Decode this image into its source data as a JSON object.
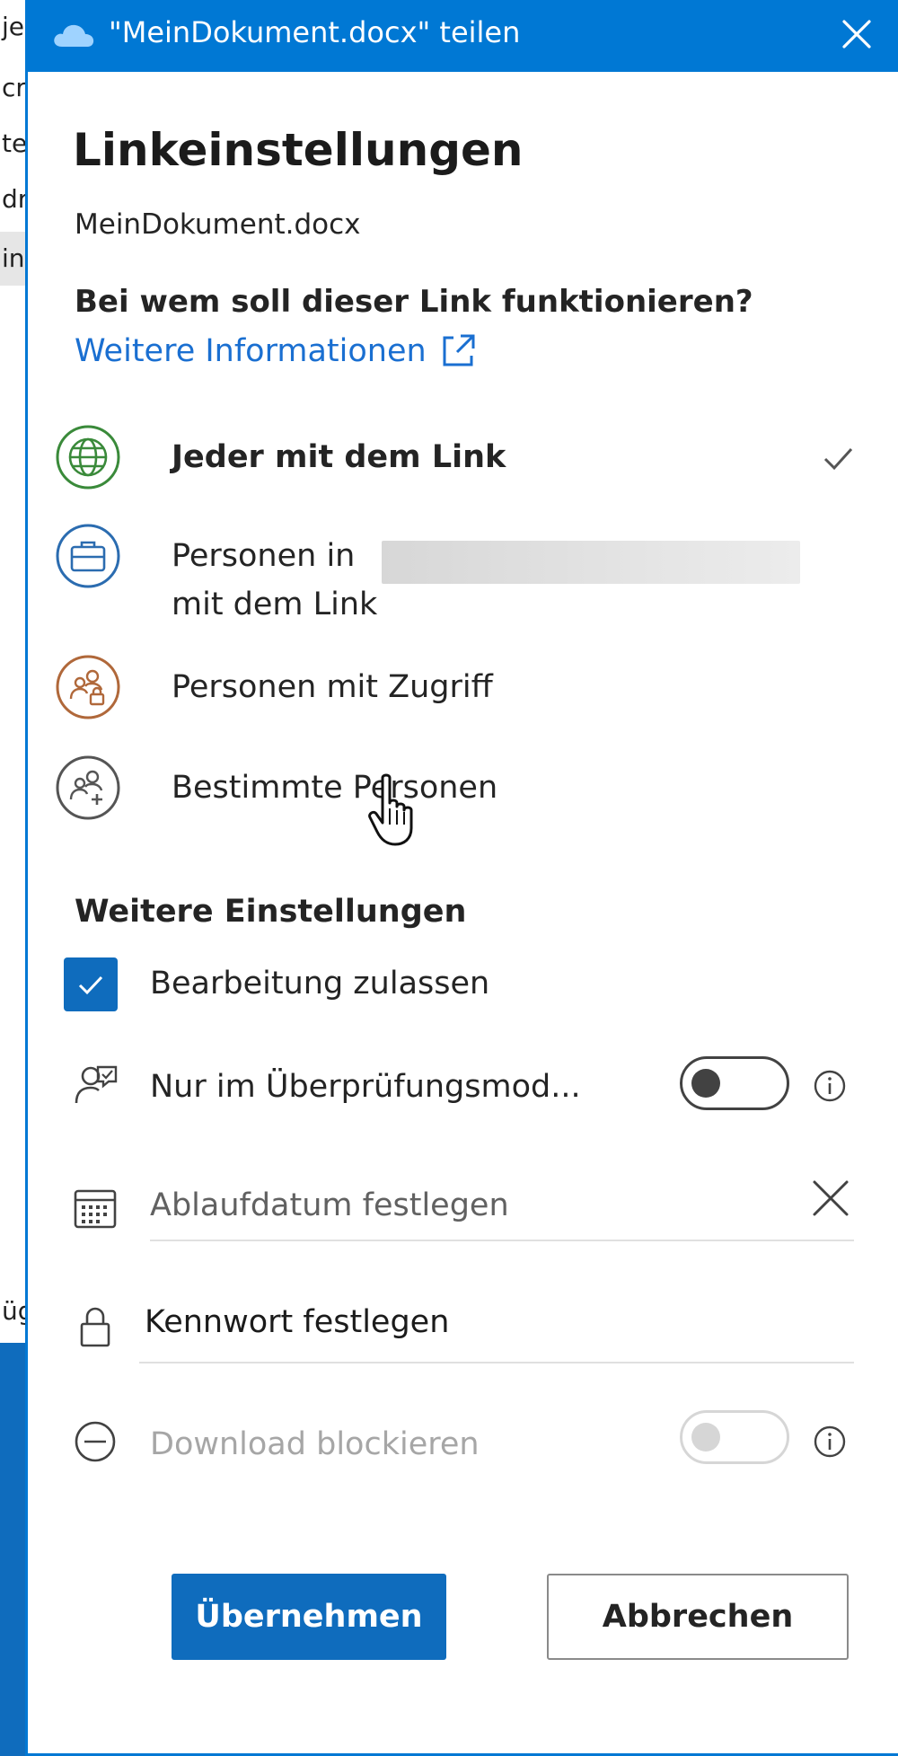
{
  "background": {
    "rows": [
      "je",
      "cro",
      "te",
      "dr",
      "in",
      "üg"
    ]
  },
  "dialog": {
    "title": "\"MeinDokument.docx\" teilen",
    "heading": "Linkeinstellungen",
    "filename": "MeinDokument.docx",
    "question": "Bei wem soll dieser Link funktionieren?",
    "more_info": "Weitere Informationen",
    "options": [
      {
        "label": "Jeder mit dem Link",
        "icon": "globe-icon",
        "selected": true,
        "color": "#3a8a3a"
      },
      {
        "label_line1": "Personen in",
        "label_line2": "mit dem Link",
        "icon": "briefcase-icon",
        "selected": false,
        "color": "#2b6cb0"
      },
      {
        "label": "Personen mit Zugriff",
        "icon": "people-lock-icon",
        "selected": false,
        "color": "#b0683a"
      },
      {
        "label": "Bestimmte Personen",
        "icon": "people-add-icon",
        "selected": false,
        "color": "#555555"
      }
    ],
    "more_settings": {
      "title": "Weitere Einstellungen",
      "allow_editing": {
        "label": "Bearbeitung zulassen",
        "checked": true
      },
      "review_mode": {
        "label": "Nur im Überprüfungsmod...",
        "on": false
      },
      "expiry": {
        "placeholder": "Ablaufdatum festlegen"
      },
      "password": {
        "label": "Kennwort festlegen"
      },
      "block_download": {
        "label": "Download blockieren",
        "on": false,
        "disabled": true
      }
    },
    "buttons": {
      "apply": "Übernehmen",
      "cancel": "Abbrechen"
    },
    "colors": {
      "accent": "#0078d4",
      "primary_button": "#0f6cbd",
      "link": "#1a6fd1"
    }
  }
}
